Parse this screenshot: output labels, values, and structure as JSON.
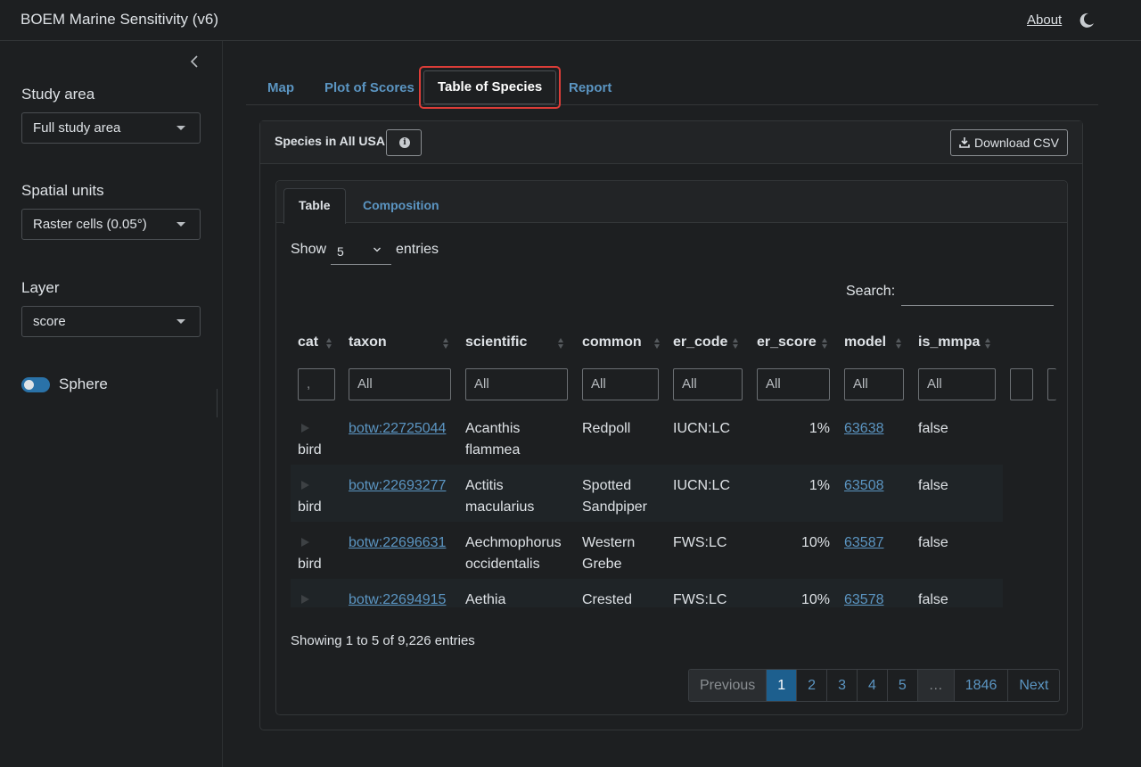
{
  "app": {
    "title": "BOEM Marine Sensitivity (v6)",
    "about": "About",
    "theme_icon": "moon-icon"
  },
  "sidebar": {
    "study_area": {
      "label": "Study area",
      "value": "Full study area"
    },
    "spatial_units": {
      "label": "Spatial units",
      "value": "Raster cells (0.05°)"
    },
    "layer": {
      "label": "Layer",
      "value": "score"
    },
    "sphere": {
      "label": "Sphere",
      "on": true
    }
  },
  "main_tabs": [
    "Map",
    "Plot of Scores",
    "Table of Species",
    "Report"
  ],
  "active_main_tab": "Table of Species",
  "card": {
    "title": "Species in All USA",
    "download": "Download CSV",
    "sub_tabs": [
      "Table",
      "Composition"
    ],
    "active_sub_tab": "Table"
  },
  "table": {
    "show_label": "Show",
    "page_length": "5",
    "entries_label": "entries",
    "search_label": "Search:",
    "search_value": "",
    "columns": [
      "cat",
      "taxon",
      "scientific",
      "common",
      "er_code",
      "er_score",
      "model",
      "is_mmpa"
    ],
    "filter_placeholder": "All",
    "rows": [
      {
        "cat": "bird",
        "taxon": "botw:22725044",
        "scientific": [
          "Acanthis",
          "flammea"
        ],
        "common": [
          "Redpoll"
        ],
        "er_code": "IUCN:LC",
        "er_score": "1%",
        "model": "63638",
        "is_mmpa": "false"
      },
      {
        "cat": "bird",
        "taxon": "botw:22693277",
        "scientific": [
          "Actitis",
          "macularius"
        ],
        "common": [
          "Spotted",
          "Sandpiper"
        ],
        "er_code": "IUCN:LC",
        "er_score": "1%",
        "model": "63508",
        "is_mmpa": "false"
      },
      {
        "cat": "bird",
        "taxon": "botw:22696631",
        "scientific": [
          "Aechmophorus",
          "occidentalis"
        ],
        "common": [
          "Western",
          "Grebe"
        ],
        "er_code": "FWS:LC",
        "er_score": "10%",
        "model": "63587",
        "is_mmpa": "false"
      },
      {
        "cat": "bird",
        "taxon": "botw:22694915",
        "scientific": [
          "Aethia",
          ""
        ],
        "common": [
          "Crested",
          ""
        ],
        "er_code": "FWS:LC",
        "er_score": "10%",
        "model": "63578",
        "is_mmpa": "false"
      }
    ],
    "info": "Showing 1 to 5 of 9,226 entries",
    "pagination": [
      "Previous",
      "1",
      "2",
      "3",
      "4",
      "5",
      "…",
      "1846",
      "Next"
    ],
    "current_page": "1"
  }
}
